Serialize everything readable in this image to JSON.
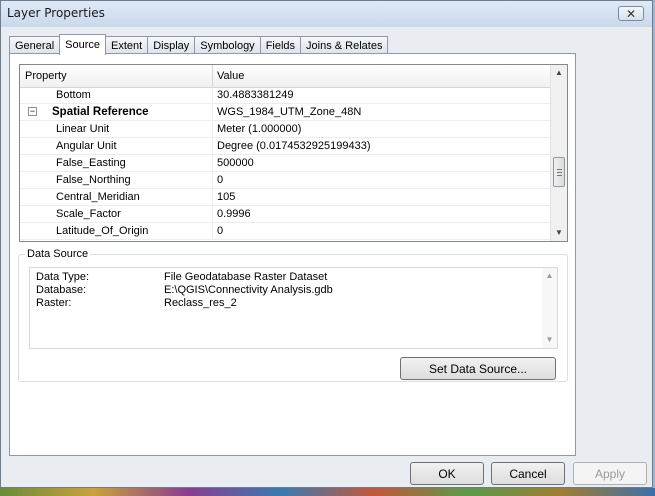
{
  "window": {
    "title": "Layer Properties",
    "close_glyph": "✕"
  },
  "tabs": [
    {
      "label": "General"
    },
    {
      "label": "Source",
      "active": true
    },
    {
      "label": "Extent"
    },
    {
      "label": "Display"
    },
    {
      "label": "Symbology"
    },
    {
      "label": "Fields"
    },
    {
      "label": "Joins & Relates"
    }
  ],
  "grid": {
    "header": {
      "property": "Property",
      "value": "Value"
    },
    "rows": [
      {
        "property": "Bottom",
        "value": "30.4883381249"
      },
      {
        "property": "Spatial Reference",
        "value": "WGS_1984_UTM_Zone_48N",
        "group": true,
        "expander": "−"
      },
      {
        "property": "Linear Unit",
        "value": "Meter (1.000000)"
      },
      {
        "property": "Angular Unit",
        "value": "Degree (0.0174532925199433)"
      },
      {
        "property": "False_Easting",
        "value": "500000"
      },
      {
        "property": "False_Northing",
        "value": "0"
      },
      {
        "property": "Central_Meridian",
        "value": "105"
      },
      {
        "property": "Scale_Factor",
        "value": "0.9996"
      },
      {
        "property": "Latitude_Of_Origin",
        "value": "0"
      }
    ]
  },
  "data_source": {
    "legend": "Data Source",
    "lines": [
      {
        "key": "Data Type:",
        "value": "File Geodatabase Raster Dataset"
      },
      {
        "key": "Database:",
        "value": "E:\\QGIS\\Connectivity Analysis.gdb"
      },
      {
        "key": "Raster:",
        "value": "Reclass_res_2"
      }
    ],
    "set_button": "Set Data Source..."
  },
  "buttons": {
    "ok": "OK",
    "cancel": "Cancel",
    "apply": "Apply"
  }
}
